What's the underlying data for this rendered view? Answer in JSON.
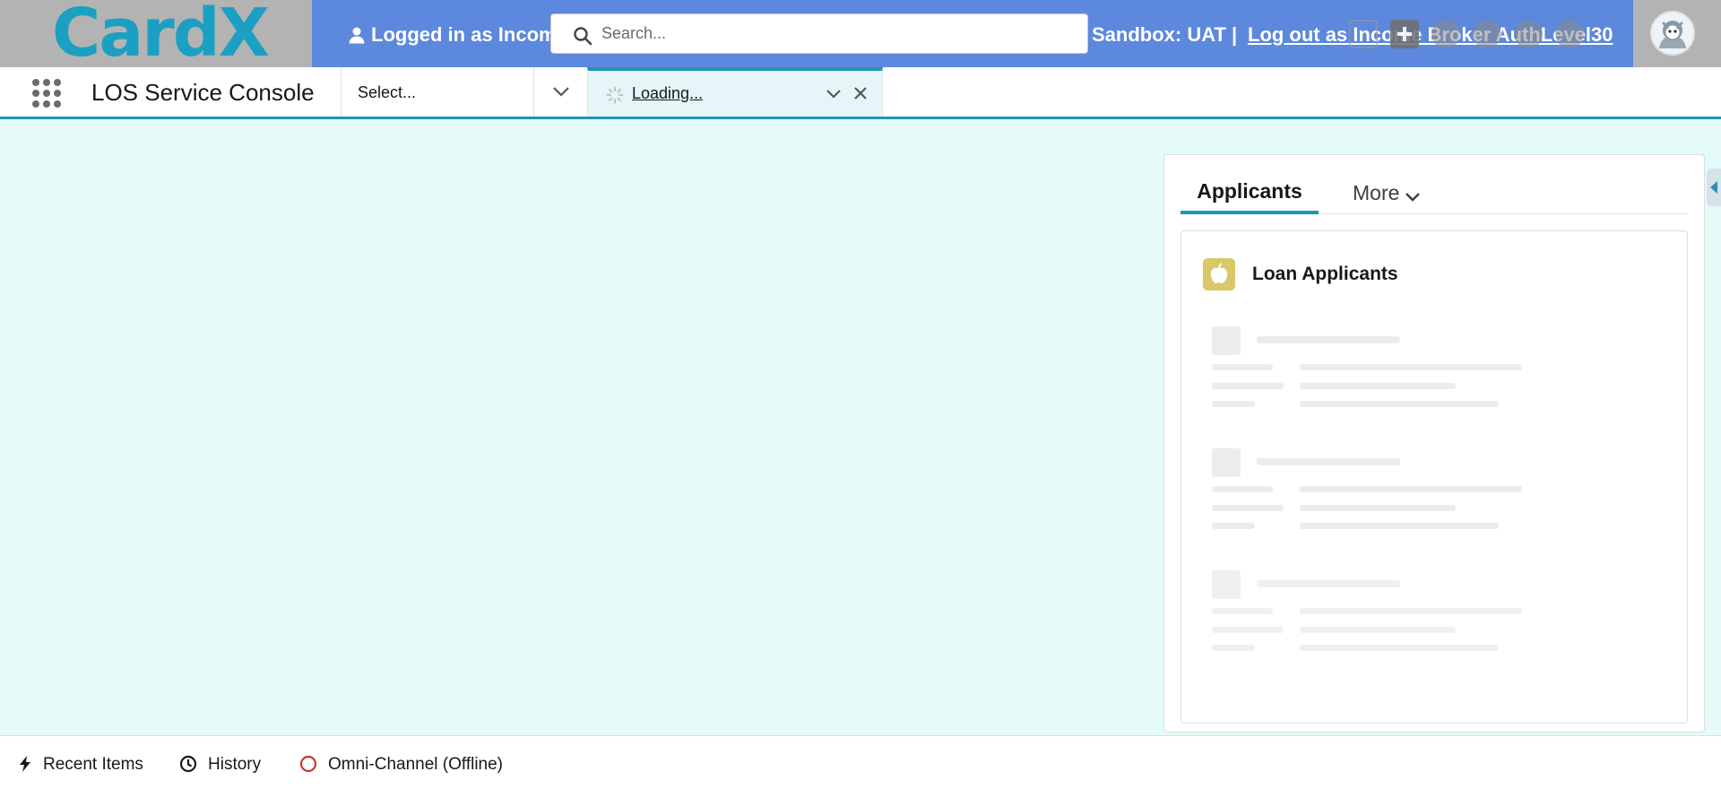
{
  "header": {
    "logo_text": "CardX",
    "logged_in_text": "Logged in as Income Broker AuthLevel30",
    "search_placeholder": "Search...",
    "sandbox_text": "Sandbox: UAT |",
    "logout_text": "Log out as Income Broker AuthLevel30"
  },
  "nav": {
    "app_name": "LOS Service Console",
    "select_text": "Select...",
    "tab_label": "Loading..."
  },
  "panel": {
    "tab_active": "Applicants",
    "tab_more": "More",
    "card_title": "Loan Applicants"
  },
  "utility_bar": {
    "recent_items": "Recent Items",
    "history": "History",
    "omni_channel": "Omni-Channel (Offline)"
  },
  "colors": {
    "header_blue": "#5c88dd",
    "accent_teal": "#1b96b5",
    "page_bg": "#e5fbf9",
    "offline_red": "#c23934"
  }
}
